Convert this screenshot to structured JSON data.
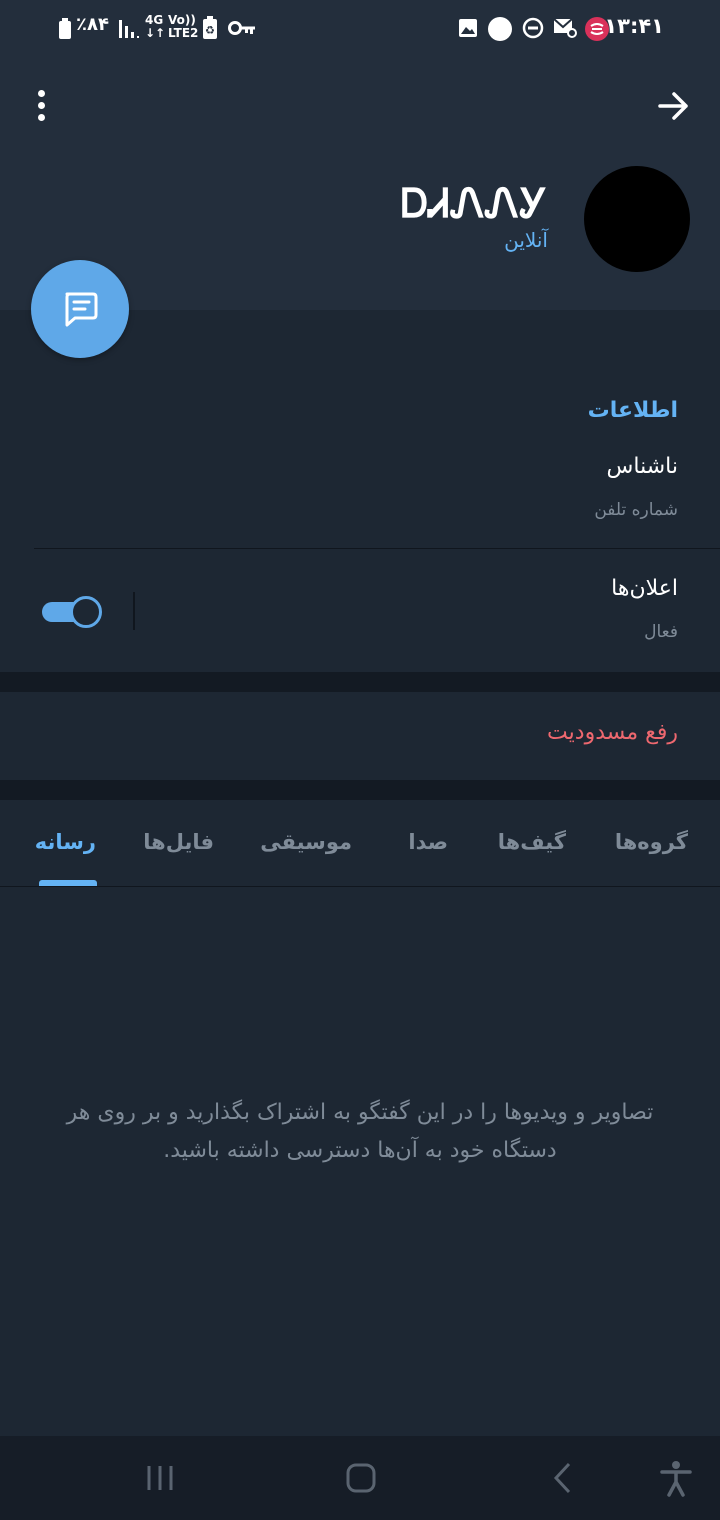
{
  "status_bar": {
    "time": "۱۳:۴۱",
    "battery": "٪۸۴",
    "network_top": "4G",
    "network_bottom": "LTE2",
    "volte": "Vo))"
  },
  "header": {
    "name": "ᎠᏗᏁᏁᎩ",
    "status": "آنلاین"
  },
  "info": {
    "section_title": "اطلاعات",
    "phone_value": "ناشناس",
    "phone_label": "شماره تلفن",
    "notifications_title": "اعلان‌ها",
    "notifications_value": "فعال",
    "notifications_enabled": true
  },
  "unblock_label": "رفع مسدودیت",
  "tabs": [
    {
      "label": "گروه‌ها",
      "active": false
    },
    {
      "label": "گیف‌ها",
      "active": false
    },
    {
      "label": "صدا",
      "active": false
    },
    {
      "label": "موسیقی",
      "active": false
    },
    {
      "label": "فایل‌ها",
      "active": false
    },
    {
      "label": "رسانه",
      "active": true
    }
  ],
  "empty_state": "تصاویر و ویدیوها را در این گفتگو به اشتراک بگذارید و بر روی هر دستگاه خود به آن‌ها دسترسی داشته باشید.",
  "colors": {
    "accent": "#64b3f4",
    "danger": "#ee686f",
    "background": "#1d2733",
    "header": "#232e3c"
  },
  "icons": {
    "menu": "more-vertical-icon",
    "back": "arrow-right-icon",
    "fab": "message-icon"
  }
}
